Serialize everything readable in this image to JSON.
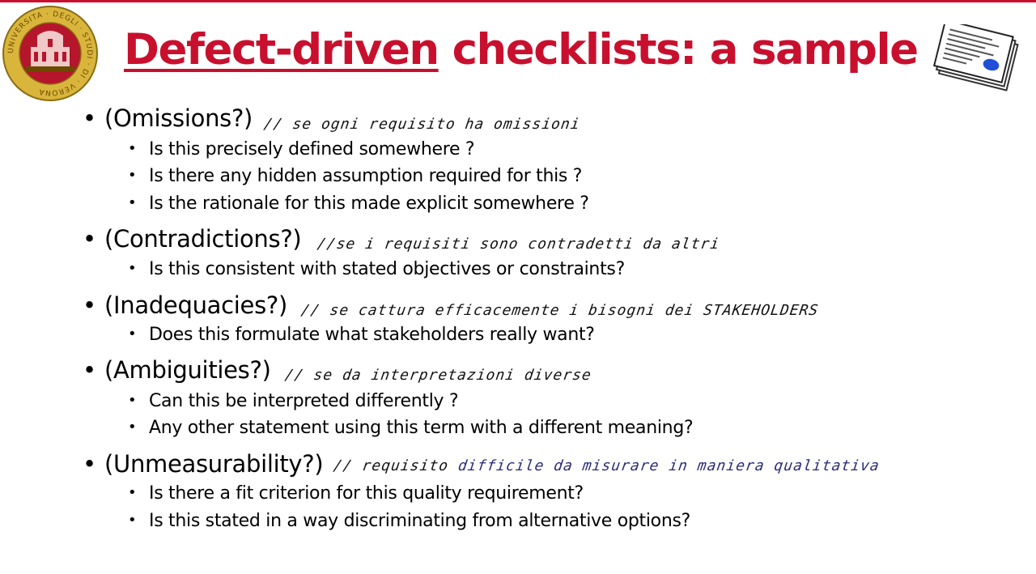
{
  "slide": {
    "title_underlined": "Defect-driven",
    "title_rest": " checklists:  a sample",
    "logo_text": "UNIVERSITA · DEGLI · STUDI · DI · VERONA"
  },
  "sections": [
    {
      "heading": "(Omissions?)",
      "note": "// se ogni requisito ha omissioni",
      "items": [
        "Is this precisely defined  somewhere ?",
        "Is there any hidden assumption required for this ?",
        "Is the rationale for this made explicit somewhere ?"
      ]
    },
    {
      "heading": "(Contradictions?)",
      "note": "//se i requisiti sono contradetti da altri",
      "items": [
        "Is this  consistent with stated objectives or constraints?"
      ]
    },
    {
      "heading": "(Inadequacies?)",
      "note": "// se cattura efficacemente i bisogni dei STAKEHOLDERS",
      "items": [
        "Does this formulate what stakeholders really want?"
      ]
    },
    {
      "heading": "(Ambiguities?)",
      "note": "// se da interpretazioni diverse",
      "items": [
        "Can this be interpreted differently ?",
        "Any other statement using this term with a different meaning?"
      ]
    },
    {
      "heading": "(Unmeasurability?)",
      "note": "// requisito",
      "note_part2": "difficile da misurare  in maniera qualitativa",
      "items": [
        "Is there a fit criterion for this quality requirement?",
        "Is this stated in a way discriminating from alternative options?"
      ]
    }
  ],
  "colors": {
    "accent": "#c8102e",
    "text": "#000000",
    "handwriting": "#111111",
    "handwriting_blue": "#2a2a7a",
    "seal_gold": "#d9b53c",
    "seal_red": "#b5162b"
  },
  "icons": [
    "university-seal-logo",
    "document-certificate-icon"
  ]
}
